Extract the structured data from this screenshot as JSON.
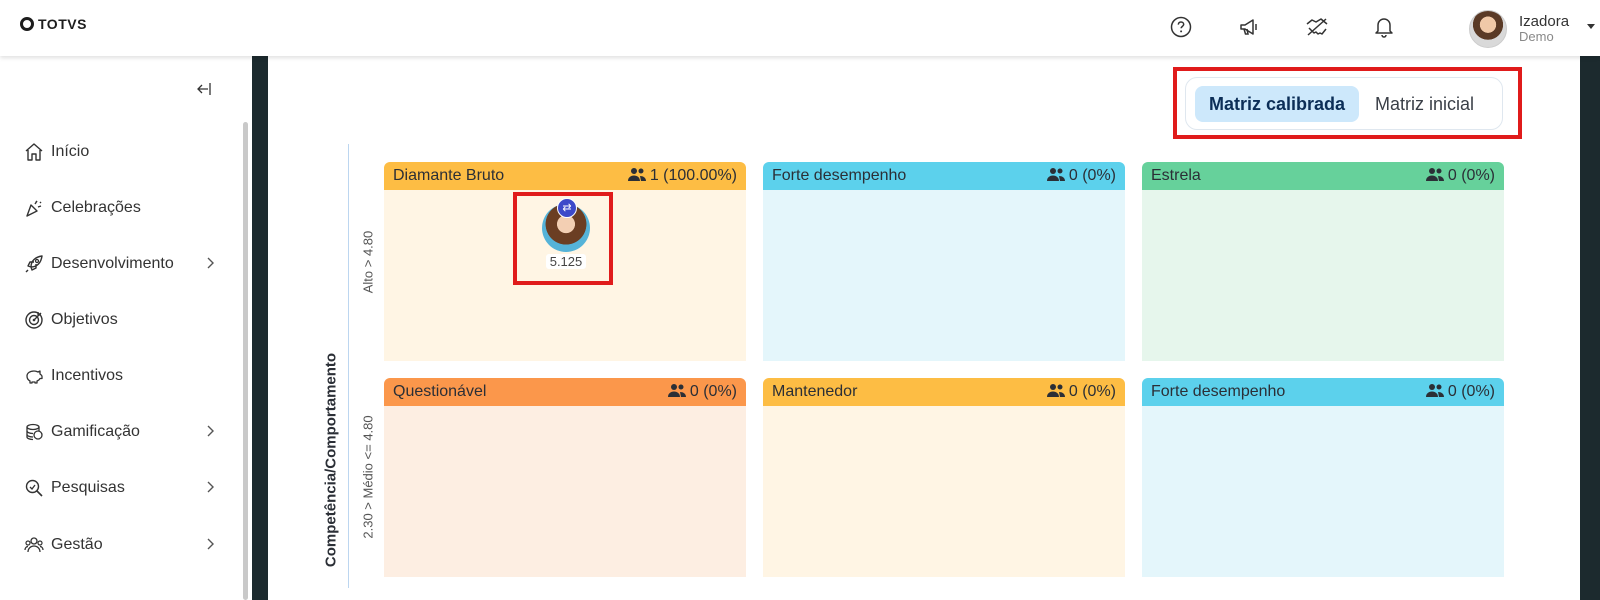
{
  "brand": {
    "name": "TOTVS"
  },
  "user": {
    "name": "Izadora",
    "subtitle": "Demo"
  },
  "topbar_icons": [
    "help-icon",
    "megaphone-icon",
    "handshake-icon",
    "bell-icon"
  ],
  "sidebar": {
    "items": [
      {
        "label": "Início",
        "icon": "home-icon",
        "has_submenu": false
      },
      {
        "label": "Celebrações",
        "icon": "party-popper-icon",
        "has_submenu": false
      },
      {
        "label": "Desenvolvimento",
        "icon": "rocket-icon",
        "has_submenu": true
      },
      {
        "label": "Objetivos",
        "icon": "target-icon",
        "has_submenu": false
      },
      {
        "label": "Incentivos",
        "icon": "piggy-bank-icon",
        "has_submenu": false
      },
      {
        "label": "Gamificação",
        "icon": "coins-icon",
        "has_submenu": true
      },
      {
        "label": "Pesquisas",
        "icon": "search-survey-icon",
        "has_submenu": true
      },
      {
        "label": "Gestão",
        "icon": "people-icon",
        "has_submenu": true
      }
    ]
  },
  "matrix_toggle": {
    "active": "Matriz calibrada",
    "inactive": "Matriz inicial"
  },
  "matrix": {
    "y_axis_title": "Competência/Comportamento",
    "row_labels": [
      "Alto > 4.80",
      "2.30 > Médio <= 4.80"
    ],
    "cells": [
      {
        "title": "Diamante Bruto",
        "count": "1 (100.00%)",
        "header_color": "#fdbd44",
        "body_color": "#fff5e4"
      },
      {
        "title": "Forte desempenho",
        "count": "0 (0%)",
        "header_color": "#5cd1ec",
        "body_color": "#e4f6fb"
      },
      {
        "title": "Estrela",
        "count": "0 (0%)",
        "header_color": "#66d19b",
        "body_color": "#e6f6ec"
      },
      {
        "title": "Questionável",
        "count": "0 (0%)",
        "header_color": "#fb974b",
        "body_color": "#fdeee2"
      },
      {
        "title": "Mantenedor",
        "count": "0 (0%)",
        "header_color": "#fdbd44",
        "body_color": "#fff5e4"
      },
      {
        "title": "Forte desempenho",
        "count": "0 (0%)",
        "header_color": "#5cd1ec",
        "body_color": "#e4f6fb"
      }
    ],
    "employee": {
      "score": "5.125",
      "badge": "⇄"
    }
  },
  "colors": {
    "highlight": "#e01b1b",
    "toggle_active_bg": "#cde8fb",
    "frame": "#1c2a2e"
  }
}
